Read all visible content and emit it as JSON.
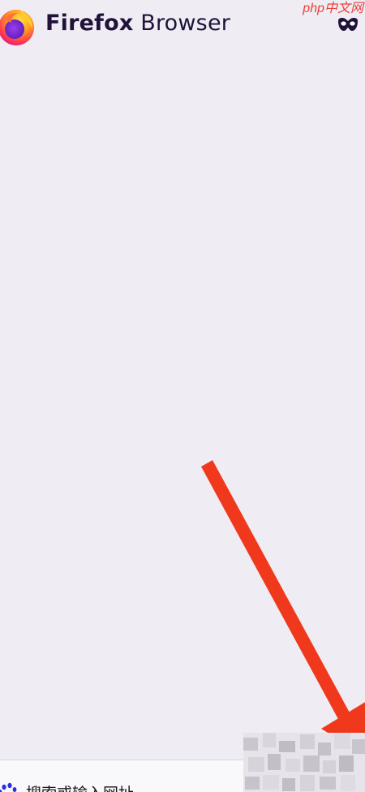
{
  "header": {
    "brand_first": "Firefox",
    "brand_second": "Browser",
    "logo_icon": "firefox-logo-icon",
    "private_icon": "private-browsing-mask-icon"
  },
  "watermark": {
    "text": "php中文网"
  },
  "toolbar": {
    "search_engine_icon": "baidu-paw-icon",
    "url_placeholder": "搜索或输入网址"
  },
  "annotation": {
    "arrow_color": "#f0391c"
  },
  "colors": {
    "background": "#efedf3",
    "brand_text": "#20123a",
    "watermark": "#e8423c",
    "baidu_blue": "#2932e1"
  }
}
